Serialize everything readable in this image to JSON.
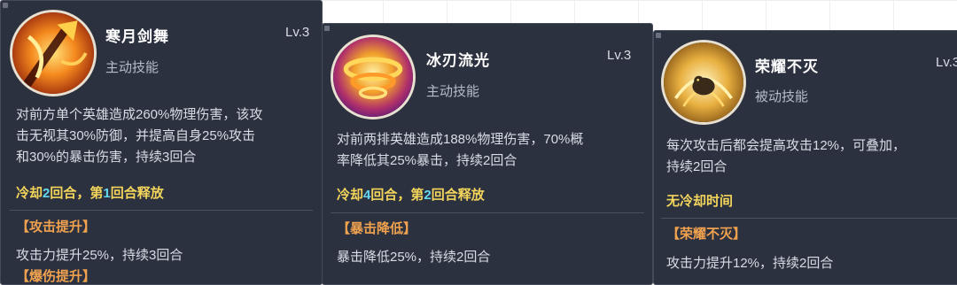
{
  "cards": [
    {
      "name": "寒月剑舞",
      "level": "Lv.3",
      "type": "主动技能",
      "icon": "fire-sword-icon",
      "desc_lines": [
        "对前方单个英雄造成260%物理伤害，该攻",
        "击无视其30%防御，并提高自身25%攻击",
        "和30%的暴击伤害，持续3回合"
      ],
      "cooldown_prefix": "冷却",
      "cooldown_num": "2",
      "cooldown_mid": "回合，第",
      "release_num": "1",
      "cooldown_suffix": "回合释放",
      "effects": [
        {
          "title": "【攻击提升】",
          "desc": "攻击力提升25%，持续3回合"
        },
        {
          "title": "【爆伤提升】",
          "desc": ""
        }
      ]
    },
    {
      "name": "冰刃流光",
      "level": "Lv.3",
      "type": "主动技能",
      "icon": "golden-vortex-icon",
      "desc_lines": [
        "对前两排英雄造成188%物理伤害，70%概",
        "率降低其25%暴击，持续2回合"
      ],
      "cooldown_prefix": "冷却",
      "cooldown_num": "4",
      "cooldown_mid": "回合，第",
      "release_num": "2",
      "cooldown_suffix": "回合释放",
      "effects": [
        {
          "title": "【暴击降低】",
          "desc": "暴击降低25%，持续2回合"
        }
      ]
    },
    {
      "name": "荣耀不灭",
      "level": "Lv.3",
      "type": "被动技能",
      "icon": "golden-beast-icon",
      "desc_lines": [
        "每次攻击后都会提高攻击12%，可叠加，",
        "持续2回合"
      ],
      "cooldown_text": "无冷却时间",
      "effects": [
        {
          "title": "【荣耀不灭】",
          "desc": "攻击力提升12%，持续2回合"
        }
      ]
    }
  ],
  "colors": {
    "panel_bg": "#2c3140",
    "cooldown_yellow": "#f2d55a",
    "cooldown_number_cyan": "#64d8f0",
    "effect_orange": "#f0a24e"
  }
}
